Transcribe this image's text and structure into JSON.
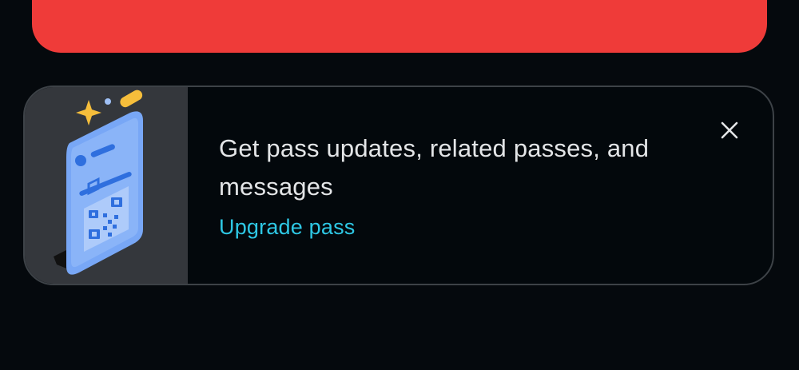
{
  "banner": {
    "color": "#ef3b39"
  },
  "promo": {
    "message": "Get pass updates, related passes, and messages",
    "link_label": "Upgrade pass",
    "accent_color": "#2ec8e5",
    "illustration_icon": "phone-pass-qr-illustration",
    "close_icon": "close-icon"
  }
}
